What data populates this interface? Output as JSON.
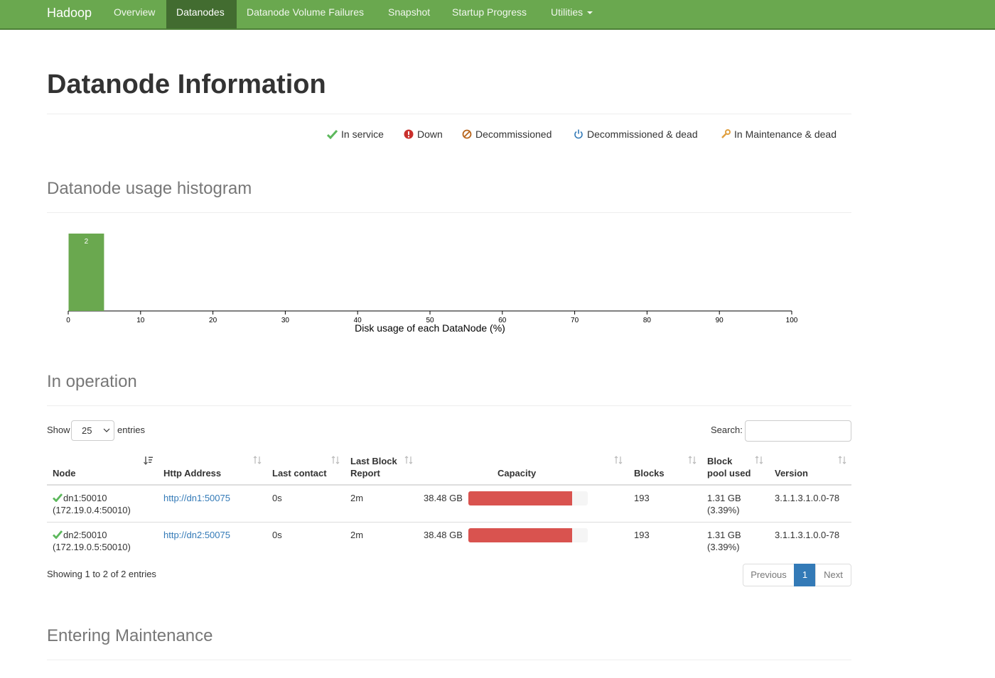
{
  "navbar": {
    "brand": "Hadoop",
    "items": [
      {
        "label": "Overview"
      },
      {
        "label": "Datanodes"
      },
      {
        "label": "Datanode Volume Failures"
      },
      {
        "label": "Snapshot"
      },
      {
        "label": "Startup Progress"
      },
      {
        "label": "Utilities"
      }
    ],
    "active": "Datanodes",
    "color": "#6aa84f"
  },
  "page": {
    "title": "Datanode Information"
  },
  "legend": [
    {
      "label": "In service",
      "icon": "check-icon",
      "color": "#5cb85c"
    },
    {
      "label": "Down",
      "icon": "exclamation-circle-icon",
      "color": "#c9302c"
    },
    {
      "label": "Decommissioned",
      "icon": "ban-icon",
      "color": "#b8651b"
    },
    {
      "label": "Decommissioned & dead",
      "icon": "power-icon",
      "color": "#337ab7"
    },
    {
      "label": "In Maintenance & dead",
      "icon": "wrench-icon",
      "color": "#e0a040"
    }
  ],
  "histogram": {
    "heading": "Datanode usage histogram",
    "chart_data": {
      "type": "bar",
      "xlabel": "Disk usage of each DataNode (%)",
      "xlim": [
        0,
        100
      ],
      "xticks": [
        "0",
        "10",
        "20",
        "30",
        "40",
        "50",
        "60",
        "70",
        "80",
        "90",
        "100"
      ],
      "bins": [
        {
          "x0": 0,
          "x1": 5,
          "count": 2,
          "label": "2"
        }
      ],
      "bar_color": "#6aa84f"
    }
  },
  "in_operation": {
    "heading": "In operation",
    "show_label": "Show",
    "page_size": "25",
    "entries_label": "entries",
    "search_label": "Search:",
    "search_value": "",
    "columns": [
      "Node",
      "Http Address",
      "Last contact",
      "Last Block Report",
      "Capacity",
      "Blocks",
      "Block pool used",
      "Version"
    ],
    "rows": [
      {
        "node": "dn1:50010",
        "node_ip": "(172.19.0.4:50010)",
        "http": "http://dn1:50075",
        "last_contact": "0s",
        "last_block_report": "2m",
        "capacity": "38.48 GB",
        "capacity_used_fraction": 0.87,
        "blocks": "193",
        "pool_used": "1.31 GB",
        "pool_used_pct": "(3.39%)",
        "version": "3.1.1.3.1.0.0-78"
      },
      {
        "node": "dn2:50010",
        "node_ip": "(172.19.0.5:50010)",
        "http": "http://dn2:50075",
        "last_contact": "0s",
        "last_block_report": "2m",
        "capacity": "38.48 GB",
        "capacity_used_fraction": 0.87,
        "blocks": "193",
        "pool_used": "1.31 GB",
        "pool_used_pct": "(3.39%)",
        "version": "3.1.1.3.1.0.0-78"
      }
    ],
    "info": "Showing 1 to 2 of 2 entries",
    "pagination": {
      "previous": "Previous",
      "current": "1",
      "next": "Next"
    }
  },
  "entering_maintenance": {
    "heading": "Entering Maintenance"
  }
}
